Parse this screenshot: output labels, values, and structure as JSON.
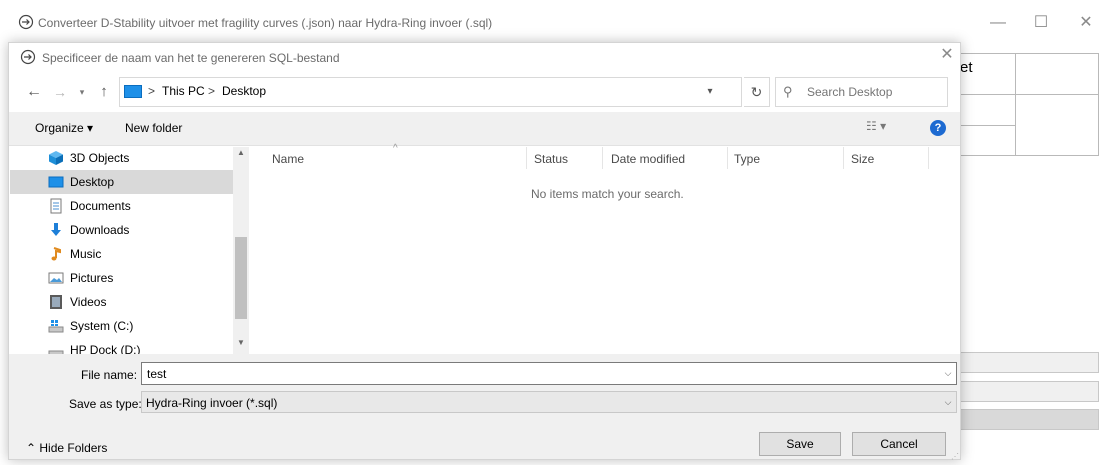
{
  "main_window": {
    "title": "Converteer D-Stability uitvoer met fragility curves (.json) naar Hydra-Ring invoer (.sql)",
    "minimize_glyph": "—",
    "maximize_glyph": "☐",
    "close_glyph": "✕",
    "table_partial_header": "et"
  },
  "dialog": {
    "title": "Specificeer de naam van het te genereren SQL-bestand",
    "close_glyph": "✕",
    "breadcrumb": {
      "separator": ">",
      "items": [
        "This PC",
        "Desktop"
      ]
    },
    "search": {
      "placeholder": "Search Desktop"
    },
    "toolbar": {
      "organize_label": "Organize ▾",
      "new_folder_label": "New folder",
      "views_glyph": "☷ ▾",
      "help_glyph": "?"
    },
    "nav_items": [
      {
        "label": "3D Objects",
        "icon": "3d-objects-icon"
      },
      {
        "label": "Desktop",
        "icon": "desktop-icon",
        "selected": true
      },
      {
        "label": "Documents",
        "icon": "documents-icon"
      },
      {
        "label": "Downloads",
        "icon": "downloads-icon"
      },
      {
        "label": "Music",
        "icon": "music-icon"
      },
      {
        "label": "Pictures",
        "icon": "pictures-icon"
      },
      {
        "label": "Videos",
        "icon": "videos-icon"
      },
      {
        "label": "System (C:)",
        "icon": "drive-icon"
      },
      {
        "label": "HP Dock (D:)",
        "icon": "drive-icon"
      }
    ],
    "columns": {
      "name": "Name",
      "status": "Status",
      "date_modified": "Date modified",
      "type": "Type",
      "size": "Size"
    },
    "empty_message": "No items match your search.",
    "file_name": {
      "label": "File name:",
      "value": "test"
    },
    "save_as_type": {
      "label": "Save as type:",
      "value": "Hydra-Ring invoer (*.sql)"
    },
    "hide_folders_label": "Hide Folders",
    "save_label": "Save",
    "cancel_label": "Cancel"
  },
  "colors": {
    "accent": "#1e90e8",
    "selection": "#d9d9d9",
    "help": "#1d6ad1"
  }
}
